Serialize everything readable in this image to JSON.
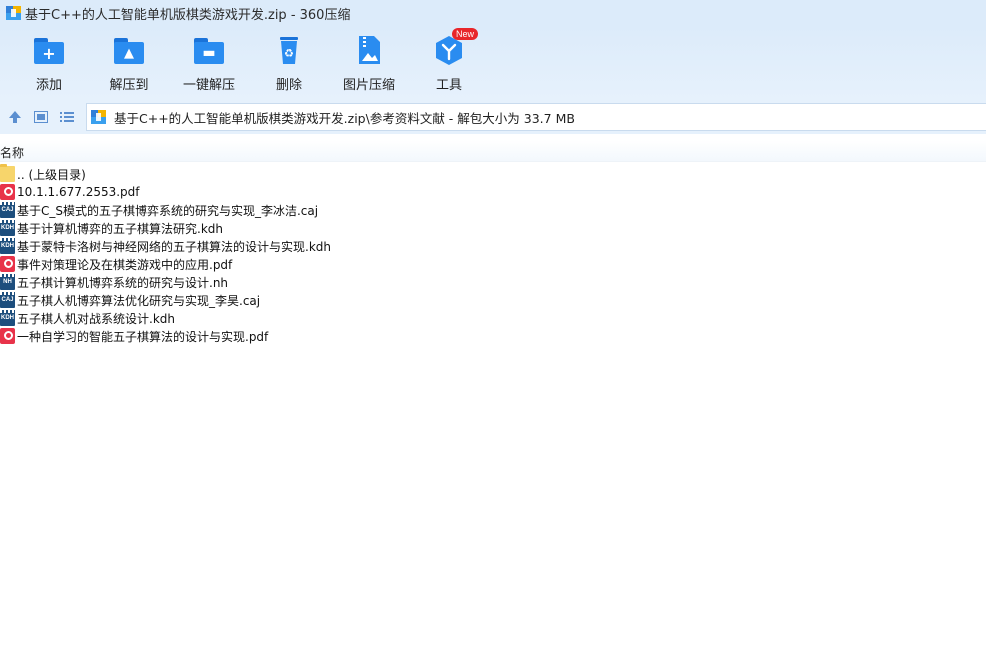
{
  "window": {
    "title": "基于C++的人工智能单机版棋类游戏开发.zip - 360压缩"
  },
  "toolbar": {
    "add": "添加",
    "extract_to": "解压到",
    "one_click_extract": "一键解压",
    "delete": "删除",
    "image_compress": "图片压缩",
    "tools": "工具",
    "tools_badge": "New"
  },
  "address": {
    "path": "基于C++的人工智能单机版棋类游戏开发.zip\\参考资料文献 - 解包大小为 33.7 MB"
  },
  "columns": {
    "name": "名称"
  },
  "files": [
    {
      "name": ".. (上级目录)",
      "type": "folder"
    },
    {
      "name": "10.1.1.677.2553.pdf",
      "type": "pdf"
    },
    {
      "name": "基于C_S模式的五子棋博弈系统的研究与实现_李冰洁.caj",
      "type": "caj"
    },
    {
      "name": "基于计算机博弈的五子棋算法研究.kdh",
      "type": "kdh"
    },
    {
      "name": "基于蒙特卡洛树与神经网络的五子棋算法的设计与实现.kdh",
      "type": "kdh"
    },
    {
      "name": "事件对策理论及在棋类游戏中的应用.pdf",
      "type": "pdf"
    },
    {
      "name": "五子棋计算机博弈系统的研究与设计.nh",
      "type": "nh"
    },
    {
      "name": "五子棋人机博弈算法优化研究与实现_李昊.caj",
      "type": "caj"
    },
    {
      "name": "五子棋人机对战系统设计.kdh",
      "type": "kdh"
    },
    {
      "name": "一种自学习的智能五子棋算法的设计与实现.pdf",
      "type": "pdf"
    }
  ],
  "icon_texts": {
    "caj": "CAJ",
    "kdh": "KDH",
    "nh": "NH"
  },
  "colors": {
    "accent": "#2a8cf0",
    "titlebar_bg": "#dcebfa",
    "badge": "#e8262a"
  }
}
